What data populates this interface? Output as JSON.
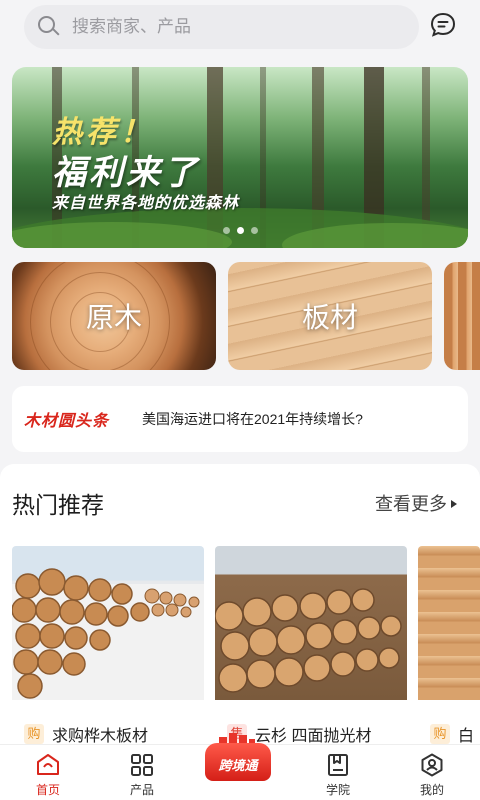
{
  "search": {
    "placeholder": "搜索商家、产品"
  },
  "icons": {
    "search": "search-icon",
    "message": "chat-bubble-icon"
  },
  "banner": {
    "line1": "热荐！",
    "line2": "福利来了",
    "line3": "来自世界各地的优选森林",
    "slides": 3,
    "active_slide": 1
  },
  "categories": [
    {
      "label": "原木"
    },
    {
      "label": "板材"
    },
    {
      "label": ""
    }
  ],
  "headline": {
    "logo": "木材圆头条",
    "text": "美国海运进口将在2021年持续增长?"
  },
  "hot": {
    "title": "热门推荐",
    "more": "查看更多",
    "items": [
      {
        "tag": "购",
        "name": "求购桦木板材"
      },
      {
        "tag": "售",
        "name": "云杉 四面抛光材"
      },
      {
        "tag": "购",
        "name": "白"
      }
    ]
  },
  "nav": {
    "items": [
      {
        "label": "首页",
        "active": true
      },
      {
        "label": "产品"
      },
      {
        "label": "跨境通"
      },
      {
        "label": "学院"
      },
      {
        "label": "我的"
      }
    ]
  },
  "colors": {
    "accent": "#d9261c",
    "buy_tag": "#e8952a",
    "sell_tag": "#e0463b"
  }
}
